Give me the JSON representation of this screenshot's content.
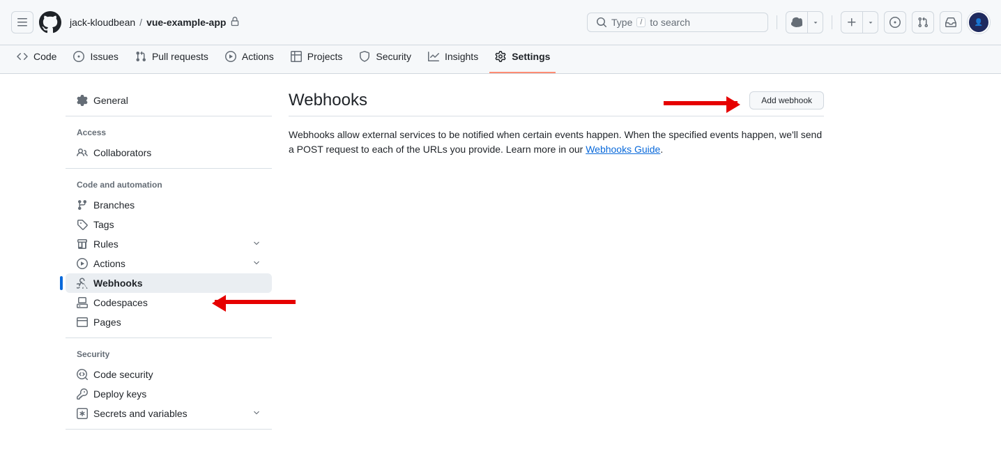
{
  "breadcrumb": {
    "owner": "jack-kloudbean",
    "sep": "/",
    "repo": "vue-example-app"
  },
  "search": {
    "prefix": "Type",
    "key": "/",
    "suffix": "to search"
  },
  "tabs": {
    "code": "Code",
    "issues": "Issues",
    "pulls": "Pull requests",
    "actions": "Actions",
    "projects": "Projects",
    "security": "Security",
    "insights": "Insights",
    "settings": "Settings"
  },
  "sidebar": {
    "general": "General",
    "access_heading": "Access",
    "collaborators": "Collaborators",
    "code_heading": "Code and automation",
    "branches": "Branches",
    "tags": "Tags",
    "rules": "Rules",
    "actions": "Actions",
    "webhooks": "Webhooks",
    "codespaces": "Codespaces",
    "pages": "Pages",
    "security_heading": "Security",
    "code_security": "Code security",
    "deploy_keys": "Deploy keys",
    "secrets": "Secrets and variables"
  },
  "page": {
    "title": "Webhooks",
    "add_btn": "Add webhook",
    "desc1": "Webhooks allow external services to be notified when certain events happen. When the specified events happen, we'll send a POST request to each of the URLs you provide. Learn more in our ",
    "link": "Webhooks Guide",
    "desc2": "."
  }
}
